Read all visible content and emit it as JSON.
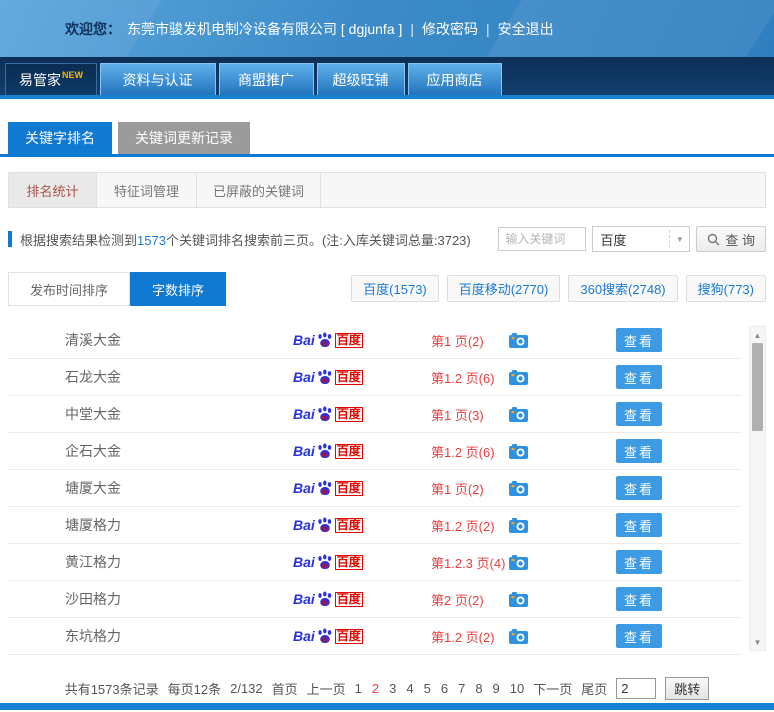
{
  "topbar": {
    "welcome_label": "欢迎您：",
    "company": "东莞市骏发机电制冷设备有限公司 [ dgjunfa ]",
    "sep1": "|",
    "change_password": "修改密码",
    "sep2": "|",
    "logout": "安全退出"
  },
  "nav": {
    "items": [
      {
        "label": "易管家",
        "badge": "NEW",
        "active": true
      },
      {
        "label": "资料与认证"
      },
      {
        "label": "商盟推广"
      },
      {
        "label": "超级旺铺"
      },
      {
        "label": "应用商店"
      }
    ]
  },
  "main_tabs": [
    {
      "label": "关键字排名",
      "active": true
    },
    {
      "label": "关键词更新记录"
    }
  ],
  "sub_tabs": [
    {
      "label": "排名统计",
      "active": true
    },
    {
      "label": "特征词管理"
    },
    {
      "label": "已屏蔽的关键词"
    }
  ],
  "summary": {
    "prefix": "根据搜索结果检测到",
    "count": "1573",
    "suffix": "个关键词排名搜索前三页。(注:入库关键词总量:3723)"
  },
  "search": {
    "placeholder": "输入关键词",
    "engine_selected": "百度",
    "button_label": "查 询"
  },
  "sort_tabs": [
    {
      "label": "发布时间排序"
    },
    {
      "label": "字数排序",
      "active": true
    }
  ],
  "engine_filters": [
    {
      "label": "百度(1573)"
    },
    {
      "label": "百度移动(2770)"
    },
    {
      "label": "360搜索(2748)"
    },
    {
      "label": "搜狗(773)"
    }
  ],
  "table": {
    "baidu_logo": {
      "bai": "Bai",
      "du": "du",
      "cn": "百度"
    },
    "view_label": "查看",
    "rows": [
      {
        "keyword": "清溪大金",
        "rank": "第1 页(2)"
      },
      {
        "keyword": "石龙大金",
        "rank": "第1.2 页(6)"
      },
      {
        "keyword": "中堂大金",
        "rank": "第1 页(3)"
      },
      {
        "keyword": "企石大金",
        "rank": "第1.2 页(6)"
      },
      {
        "keyword": "塘厦大金",
        "rank": "第1 页(2)"
      },
      {
        "keyword": "塘厦格力",
        "rank": "第1.2 页(2)"
      },
      {
        "keyword": "黄江格力",
        "rank": "第1.2.3 页(4)"
      },
      {
        "keyword": "沙田格力",
        "rank": "第2 页(2)"
      },
      {
        "keyword": "东坑格力",
        "rank": "第1.2 页(2)"
      }
    ]
  },
  "pagination": {
    "total_text": "共有1573条记录",
    "per_page_text": "每页12条",
    "page_indicator": "2/132",
    "first": "首页",
    "prev": "上一页",
    "pages": [
      {
        "label": "1"
      },
      {
        "label": "2",
        "active": true
      },
      {
        "label": "3"
      },
      {
        "label": "4"
      },
      {
        "label": "5"
      },
      {
        "label": "6"
      },
      {
        "label": "7"
      },
      {
        "label": "8"
      },
      {
        "label": "9"
      },
      {
        "label": "10"
      }
    ],
    "next": "下一页",
    "last": "尾页",
    "jump_value": "2",
    "jump_label": "跳转"
  },
  "colors": {
    "accent_blue": "#1079d1",
    "nav_dark": "#0d2f56",
    "rank_red": "#e83f3f",
    "badge_orange": "#ffb400",
    "baidu_blue": "#2932e1",
    "baidu_red": "#e10601"
  }
}
